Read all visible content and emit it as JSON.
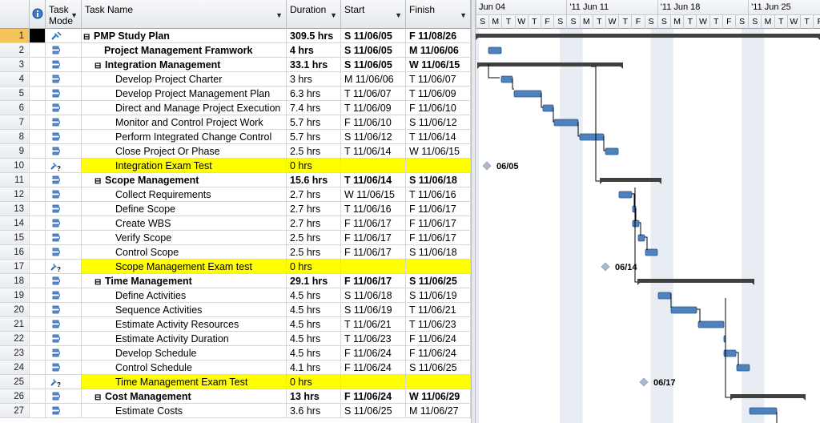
{
  "columns": {
    "info_icon": "info-icon",
    "task_mode": "Task Mode",
    "task_name": "Task Name",
    "duration": "Duration",
    "start": "Start",
    "finish": "Finish"
  },
  "tasks": [
    {
      "id": "1",
      "mode": "manual-pin",
      "name": "PMP Study Plan",
      "dur": "309.5 hrs",
      "start": "S 11/06/05",
      "finish": "F 11/08/26",
      "level": 0,
      "summary": true,
      "bold": true,
      "hl": false
    },
    {
      "id": "2",
      "mode": "auto",
      "name": "Project Management Framwork",
      "dur": "4 hrs",
      "start": "S 11/06/05",
      "finish": "M 11/06/06",
      "level": 1,
      "summary": false,
      "bold": true,
      "hl": false
    },
    {
      "id": "3",
      "mode": "auto",
      "name": "Integration Management",
      "dur": "33.1 hrs",
      "start": "S 11/06/05",
      "finish": "W 11/06/15",
      "level": 1,
      "summary": true,
      "bold": true,
      "hl": false
    },
    {
      "id": "4",
      "mode": "auto",
      "name": "Develop Project Charter",
      "dur": "3 hrs",
      "start": "M 11/06/06",
      "finish": "T 11/06/07",
      "level": 2,
      "summary": false,
      "bold": false,
      "hl": false
    },
    {
      "id": "5",
      "mode": "auto",
      "name": "Develop Project Management Plan",
      "dur": "6.3 hrs",
      "start": "T 11/06/07",
      "finish": "T 11/06/09",
      "level": 2,
      "summary": false,
      "bold": false,
      "hl": false
    },
    {
      "id": "6",
      "mode": "auto",
      "name": "Direct and Manage Project Execution",
      "dur": "7.4 hrs",
      "start": "T 11/06/09",
      "finish": "F 11/06/10",
      "level": 2,
      "summary": false,
      "bold": false,
      "hl": false
    },
    {
      "id": "7",
      "mode": "auto",
      "name": "Monitor and Control Project Work",
      "dur": "5.7 hrs",
      "start": "F 11/06/10",
      "finish": "S 11/06/12",
      "level": 2,
      "summary": false,
      "bold": false,
      "hl": false
    },
    {
      "id": "8",
      "mode": "auto",
      "name": "Perform Integrated Change Control",
      "dur": "5.7 hrs",
      "start": "S 11/06/12",
      "finish": "T 11/06/14",
      "level": 2,
      "summary": false,
      "bold": false,
      "hl": false
    },
    {
      "id": "9",
      "mode": "auto",
      "name": "Close Project Or Phase",
      "dur": "2.5 hrs",
      "start": "T 11/06/14",
      "finish": "W 11/06/15",
      "level": 2,
      "summary": false,
      "bold": false,
      "hl": false
    },
    {
      "id": "10",
      "mode": "manual-q",
      "name": "Integration Exam Test",
      "dur": "0 hrs",
      "start": "",
      "finish": "",
      "level": 2,
      "summary": false,
      "bold": false,
      "hl": true
    },
    {
      "id": "11",
      "mode": "auto",
      "name": "Scope Management",
      "dur": "15.6 hrs",
      "start": "T 11/06/14",
      "finish": "S 11/06/18",
      "level": 1,
      "summary": true,
      "bold": true,
      "hl": false
    },
    {
      "id": "12",
      "mode": "auto",
      "name": "Collect Requirements",
      "dur": "2.7 hrs",
      "start": "W 11/06/15",
      "finish": "T 11/06/16",
      "level": 2,
      "summary": false,
      "bold": false,
      "hl": false
    },
    {
      "id": "13",
      "mode": "auto",
      "name": "Define Scope",
      "dur": "2.7 hrs",
      "start": "T 11/06/16",
      "finish": "F 11/06/17",
      "level": 2,
      "summary": false,
      "bold": false,
      "hl": false
    },
    {
      "id": "14",
      "mode": "auto",
      "name": "Create WBS",
      "dur": "2.7 hrs",
      "start": "F 11/06/17",
      "finish": "F 11/06/17",
      "level": 2,
      "summary": false,
      "bold": false,
      "hl": false
    },
    {
      "id": "15",
      "mode": "auto",
      "name": "Verify Scope",
      "dur": "2.5 hrs",
      "start": "F 11/06/17",
      "finish": "F 11/06/17",
      "level": 2,
      "summary": false,
      "bold": false,
      "hl": false
    },
    {
      "id": "16",
      "mode": "auto",
      "name": "Control Scope",
      "dur": "2.5 hrs",
      "start": "F 11/06/17",
      "finish": "S 11/06/18",
      "level": 2,
      "summary": false,
      "bold": false,
      "hl": false
    },
    {
      "id": "17",
      "mode": "manual-q",
      "name": "Scope Management Exam test",
      "dur": "0 hrs",
      "start": "",
      "finish": "",
      "level": 2,
      "summary": false,
      "bold": false,
      "hl": true
    },
    {
      "id": "18",
      "mode": "auto",
      "name": "Time Management",
      "dur": "29.1 hrs",
      "start": "F 11/06/17",
      "finish": "S 11/06/25",
      "level": 1,
      "summary": true,
      "bold": true,
      "hl": false
    },
    {
      "id": "19",
      "mode": "auto",
      "name": "Define Activities",
      "dur": "4.5 hrs",
      "start": "S 11/06/18",
      "finish": "S 11/06/19",
      "level": 2,
      "summary": false,
      "bold": false,
      "hl": false
    },
    {
      "id": "20",
      "mode": "auto",
      "name": "Sequence Activities",
      "dur": "4.5 hrs",
      "start": "S 11/06/19",
      "finish": "T 11/06/21",
      "level": 2,
      "summary": false,
      "bold": false,
      "hl": false
    },
    {
      "id": "21",
      "mode": "auto",
      "name": "Estimate Activity Resources",
      "dur": "4.5 hrs",
      "start": "T 11/06/21",
      "finish": "T 11/06/23",
      "level": 2,
      "summary": false,
      "bold": false,
      "hl": false
    },
    {
      "id": "22",
      "mode": "auto",
      "name": "Estimate Activity Duration",
      "dur": "4.5 hrs",
      "start": "T 11/06/23",
      "finish": "F 11/06/24",
      "level": 2,
      "summary": false,
      "bold": false,
      "hl": false
    },
    {
      "id": "23",
      "mode": "auto",
      "name": "Develop Schedule",
      "dur": "4.5 hrs",
      "start": "F 11/06/24",
      "finish": "F 11/06/24",
      "level": 2,
      "summary": false,
      "bold": false,
      "hl": false
    },
    {
      "id": "24",
      "mode": "auto",
      "name": "Control Schedule",
      "dur": "4.1 hrs",
      "start": "F 11/06/24",
      "finish": "S 11/06/25",
      "level": 2,
      "summary": false,
      "bold": false,
      "hl": false
    },
    {
      "id": "25",
      "mode": "manual-q",
      "name": "Time Management Exam Test",
      "dur": "0 hrs",
      "start": "",
      "finish": "",
      "level": 2,
      "summary": false,
      "bold": false,
      "hl": true
    },
    {
      "id": "26",
      "mode": "auto",
      "name": "Cost Management",
      "dur": "13 hrs",
      "start": "F 11/06/24",
      "finish": "W 11/06/29",
      "level": 1,
      "summary": true,
      "bold": true,
      "hl": false
    },
    {
      "id": "27",
      "mode": "auto",
      "name": "Estimate Costs",
      "dur": "3.6 hrs",
      "start": "S 11/06/25",
      "finish": "M 11/06/27",
      "level": 2,
      "summary": false,
      "bold": false,
      "hl": false
    }
  ],
  "timeline": {
    "weeks": [
      "Jun 04",
      "'11 Jun 11",
      "'11 Jun 18",
      "'11 Jun 25"
    ],
    "day_letters": [
      "S",
      "M",
      "T",
      "W",
      "T",
      "F",
      "S",
      "S",
      "M",
      "T",
      "W",
      "T",
      "F",
      "S",
      "S",
      "M",
      "T",
      "W",
      "T",
      "F",
      "S",
      "S",
      "M",
      "T",
      "W",
      "T",
      "F"
    ]
  },
  "gantt": {
    "bar_color": "#4f81bd",
    "summary_color": "#404040",
    "milestone_color": "#a9b8cf",
    "weekend_shade": "#e8ecf3",
    "selected_row_color": "#f6c55a",
    "highlight_color": "#ffff00",
    "milestone_labels": [
      "06/05",
      "06/14",
      "06/17"
    ]
  }
}
